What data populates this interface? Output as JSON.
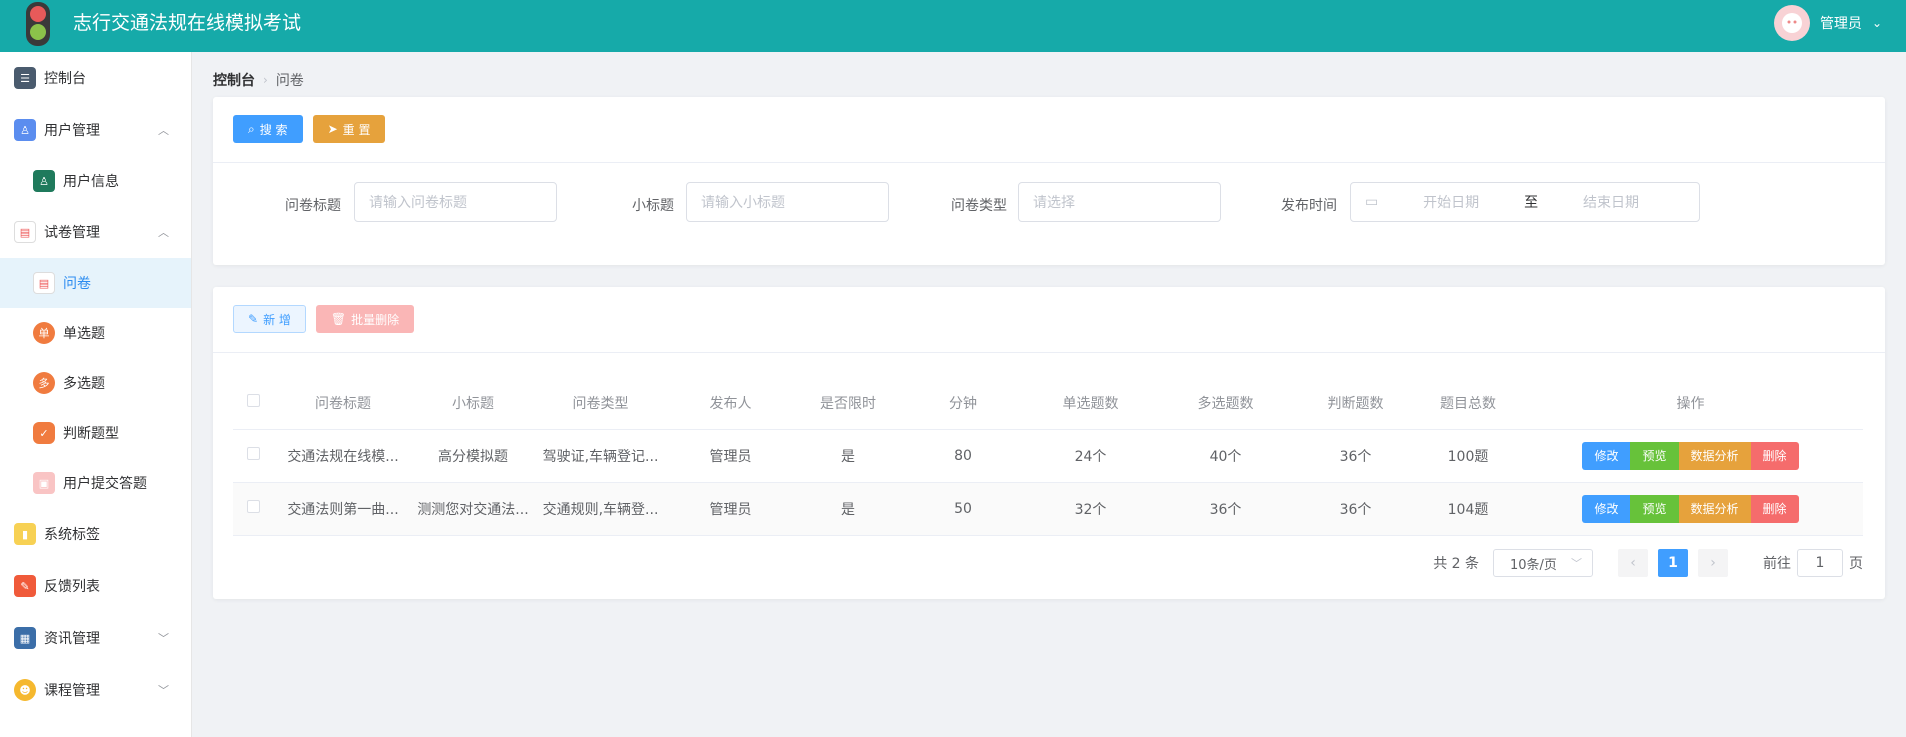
{
  "header": {
    "title": "志行交通法规在线模拟考试",
    "user_name": "管理员"
  },
  "sidebar": {
    "items": [
      {
        "label": "控制台",
        "icon": "dashboard-icon"
      },
      {
        "label": "用户管理",
        "icon": "user-mgmt-icon"
      },
      {
        "label": "用户信息",
        "icon": "user-info-icon"
      },
      {
        "label": "试卷管理",
        "icon": "paper-mgmt-icon"
      },
      {
        "label": "问卷",
        "icon": "questionnaire-icon"
      },
      {
        "label": "单选题",
        "icon": "single-choice-icon",
        "badge": "单"
      },
      {
        "label": "多选题",
        "icon": "multi-choice-icon",
        "badge": "多"
      },
      {
        "label": "判断题型",
        "icon": "judge-icon"
      },
      {
        "label": "用户提交答题",
        "icon": "user-submit-icon"
      },
      {
        "label": "系统标签",
        "icon": "tag-icon"
      },
      {
        "label": "反馈列表",
        "icon": "feedback-icon"
      },
      {
        "label": "资讯管理",
        "icon": "news-icon"
      },
      {
        "label": "课程管理",
        "icon": "course-icon"
      }
    ]
  },
  "breadcrumb": {
    "root": "控制台",
    "current": "问卷"
  },
  "search": {
    "search_label": "搜 索",
    "reset_label": "重 置",
    "fields": {
      "title_label": "问卷标题",
      "title_placeholder": "请输入问卷标题",
      "subtitle_label": "小标题",
      "subtitle_placeholder": "请输入小标题",
      "type_label": "问卷类型",
      "type_placeholder": "请选择",
      "date_label": "发布时间",
      "date_start": "开始日期",
      "date_sep": "至",
      "date_end": "结束日期"
    }
  },
  "toolbar": {
    "add_label": "新 增",
    "batch_delete_label": "批量删除"
  },
  "table": {
    "headers": [
      "问卷标题",
      "小标题",
      "问卷类型",
      "发布人",
      "是否限时",
      "分钟",
      "单选题数",
      "多选题数",
      "判断题数",
      "题目总数",
      "操作"
    ],
    "rows": [
      [
        "交通法规在线模...",
        "高分模拟题",
        "驾驶证,车辆登记...",
        "管理员",
        "是",
        "80",
        "24个",
        "40个",
        "36个",
        "100题"
      ],
      [
        "交通法则第一曲...",
        "测测您对交通法...",
        "交通规则,车辆登...",
        "管理员",
        "是",
        "50",
        "32个",
        "36个",
        "36个",
        "104题"
      ]
    ],
    "actions": {
      "edit": "修改",
      "preview": "预览",
      "analysis": "数据分析",
      "delete": "删除"
    }
  },
  "pagination": {
    "total": "共 2 条",
    "page_size": "10条/页",
    "current": "1",
    "goto_prefix": "前往",
    "goto_value": "1",
    "goto_suffix": "页"
  }
}
